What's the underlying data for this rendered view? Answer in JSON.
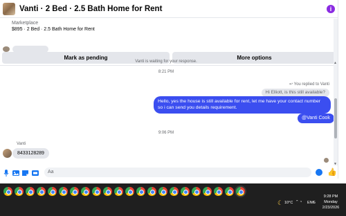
{
  "header": {
    "title": "Vanti · 2 Bed · 2.5 Bath Home for Rent",
    "info_icon": "i"
  },
  "listing": {
    "source": "Marketplace",
    "summary": "$895 · 2 Bed · 2.5 Bath Home for Rent",
    "mark_pending_label": "Mark as pending",
    "more_options_label": "More options"
  },
  "messages": {
    "waiting_notice": "Vanti is waiting for your response.",
    "timestamp_1": "8:21 PM",
    "replied_label": "You replied to Vanti",
    "quoted_text": "Hi Elliott, is this still available?",
    "outgoing_reply": "Hello, yes the house is still available for rent, let me have your contact number so i can send you details requirement.",
    "outgoing_mention": "@Vanti Cook",
    "timestamp_2": "9:06 PM",
    "sender_name": "Vanti",
    "incoming_text": "8433128289"
  },
  "composer": {
    "placeholder": "Aa"
  },
  "taskbar": {
    "app_count": 22,
    "temperature": "10°C",
    "language": "ENG",
    "time": "9:28 PM",
    "day": "Monday",
    "date": "2/23/2026"
  },
  "colors": {
    "accent": "#3b4ef0",
    "brand": "#1877f2",
    "info": "#8a2be2"
  }
}
